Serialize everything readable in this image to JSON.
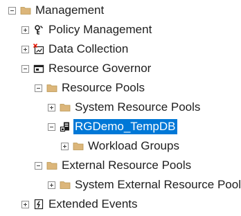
{
  "tree": {
    "management": "Management",
    "policy_management": "Policy Management",
    "data_collection": "Data Collection",
    "resource_governor": "Resource Governor",
    "resource_pools": "Resource Pools",
    "system_resource_pools": "System Resource Pools",
    "rgdemo_tempdb": "RGDemo_TempDB",
    "workload_groups": "Workload Groups",
    "external_resource_pools": "External Resource Pools",
    "system_external_resource_pools": "System External Resource Pool",
    "extended_events": "Extended Events"
  },
  "colors": {
    "selection": "#0078d7",
    "folder": "#dcb67a"
  }
}
